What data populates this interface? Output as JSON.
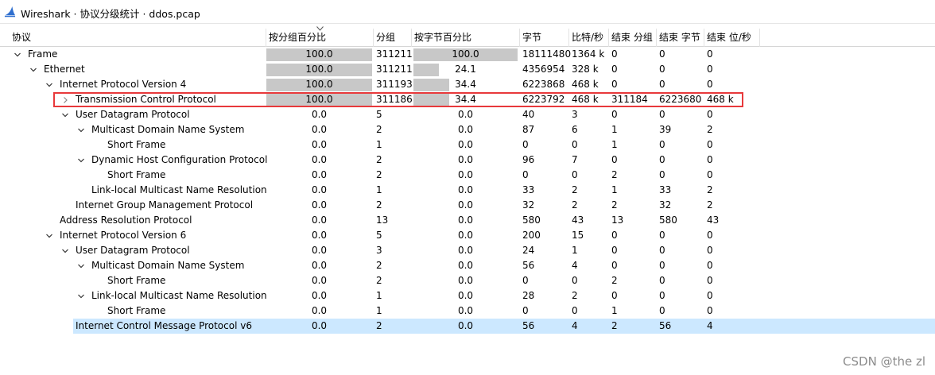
{
  "window": {
    "title": "Wireshark · 协议分级统计 · ddos.pcap",
    "icon": "wireshark-fin-icon"
  },
  "columns": [
    "协议",
    "按分组百分比",
    "分组",
    "按字节百分比",
    "字节",
    "比特/秒",
    "结束 分组",
    "结束 字节",
    "结束 位/秒"
  ],
  "sorted_column_index": 1,
  "rows": [
    {
      "depth": 0,
      "toggle": "expanded",
      "protocol": "Frame",
      "pct_packets": "100.0",
      "packets": "311211",
      "pct_bytes": "100.0",
      "bytes": "18111480",
      "bps": "1364 k",
      "end_packets": "0",
      "end_bytes": "0",
      "end_bps": "0",
      "pct_packets_fill": 100,
      "pct_bytes_fill": 100
    },
    {
      "depth": 1,
      "toggle": "expanded",
      "protocol": "Ethernet",
      "pct_packets": "100.0",
      "packets": "311211",
      "pct_bytes": "24.1",
      "bytes": "4356954",
      "bps": "328 k",
      "end_packets": "0",
      "end_bytes": "0",
      "end_bps": "0",
      "pct_packets_fill": 100,
      "pct_bytes_fill": 24.1
    },
    {
      "depth": 2,
      "toggle": "expanded",
      "protocol": "Internet Protocol Version 4",
      "pct_packets": "100.0",
      "packets": "311193",
      "pct_bytes": "34.4",
      "bytes": "6223868",
      "bps": "468 k",
      "end_packets": "0",
      "end_bytes": "0",
      "end_bps": "0",
      "pct_packets_fill": 100,
      "pct_bytes_fill": 34.4
    },
    {
      "depth": 3,
      "toggle": "collapsed",
      "protocol": "Transmission Control Protocol",
      "pct_packets": "100.0",
      "packets": "311186",
      "pct_bytes": "34.4",
      "bytes": "6223792",
      "bps": "468 k",
      "end_packets": "311184",
      "end_bytes": "6223680",
      "end_bps": "468 k",
      "pct_packets_fill": 100,
      "pct_bytes_fill": 34.4
    },
    {
      "depth": 3,
      "toggle": "expanded",
      "protocol": "User Datagram Protocol",
      "pct_packets": "0.0",
      "packets": "5",
      "pct_bytes": "0.0",
      "bytes": "40",
      "bps": "3",
      "end_packets": "0",
      "end_bytes": "0",
      "end_bps": "0",
      "pct_packets_fill": 0,
      "pct_bytes_fill": 0
    },
    {
      "depth": 4,
      "toggle": "expanded",
      "protocol": "Multicast Domain Name System",
      "pct_packets": "0.0",
      "packets": "2",
      "pct_bytes": "0.0",
      "bytes": "87",
      "bps": "6",
      "end_packets": "1",
      "end_bytes": "39",
      "end_bps": "2",
      "pct_packets_fill": 0,
      "pct_bytes_fill": 0
    },
    {
      "depth": 5,
      "toggle": "none",
      "protocol": "Short Frame",
      "pct_packets": "0.0",
      "packets": "1",
      "pct_bytes": "0.0",
      "bytes": "0",
      "bps": "0",
      "end_packets": "1",
      "end_bytes": "0",
      "end_bps": "0",
      "pct_packets_fill": 0,
      "pct_bytes_fill": 0
    },
    {
      "depth": 4,
      "toggle": "expanded",
      "protocol": "Dynamic Host Configuration Protocol",
      "pct_packets": "0.0",
      "packets": "2",
      "pct_bytes": "0.0",
      "bytes": "96",
      "bps": "7",
      "end_packets": "0",
      "end_bytes": "0",
      "end_bps": "0",
      "pct_packets_fill": 0,
      "pct_bytes_fill": 0
    },
    {
      "depth": 5,
      "toggle": "none",
      "protocol": "Short Frame",
      "pct_packets": "0.0",
      "packets": "2",
      "pct_bytes": "0.0",
      "bytes": "0",
      "bps": "0",
      "end_packets": "2",
      "end_bytes": "0",
      "end_bps": "0",
      "pct_packets_fill": 0,
      "pct_bytes_fill": 0
    },
    {
      "depth": 4,
      "toggle": "none",
      "protocol": "Link-local Multicast Name Resolution",
      "pct_packets": "0.0",
      "packets": "1",
      "pct_bytes": "0.0",
      "bytes": "33",
      "bps": "2",
      "end_packets": "1",
      "end_bytes": "33",
      "end_bps": "2",
      "pct_packets_fill": 0,
      "pct_bytes_fill": 0
    },
    {
      "depth": 3,
      "toggle": "none",
      "protocol": "Internet Group Management Protocol",
      "pct_packets": "0.0",
      "packets": "2",
      "pct_bytes": "0.0",
      "bytes": "32",
      "bps": "2",
      "end_packets": "2",
      "end_bytes": "32",
      "end_bps": "2",
      "pct_packets_fill": 0,
      "pct_bytes_fill": 0
    },
    {
      "depth": 2,
      "toggle": "none",
      "protocol": "Address Resolution Protocol",
      "pct_packets": "0.0",
      "packets": "13",
      "pct_bytes": "0.0",
      "bytes": "580",
      "bps": "43",
      "end_packets": "13",
      "end_bytes": "580",
      "end_bps": "43",
      "pct_packets_fill": 0,
      "pct_bytes_fill": 0
    },
    {
      "depth": 2,
      "toggle": "expanded",
      "protocol": "Internet Protocol Version 6",
      "pct_packets": "0.0",
      "packets": "5",
      "pct_bytes": "0.0",
      "bytes": "200",
      "bps": "15",
      "end_packets": "0",
      "end_bytes": "0",
      "end_bps": "0",
      "pct_packets_fill": 0,
      "pct_bytes_fill": 0
    },
    {
      "depth": 3,
      "toggle": "expanded",
      "protocol": "User Datagram Protocol",
      "pct_packets": "0.0",
      "packets": "3",
      "pct_bytes": "0.0",
      "bytes": "24",
      "bps": "1",
      "end_packets": "0",
      "end_bytes": "0",
      "end_bps": "0",
      "pct_packets_fill": 0,
      "pct_bytes_fill": 0
    },
    {
      "depth": 4,
      "toggle": "expanded",
      "protocol": "Multicast Domain Name System",
      "pct_packets": "0.0",
      "packets": "2",
      "pct_bytes": "0.0",
      "bytes": "56",
      "bps": "4",
      "end_packets": "0",
      "end_bytes": "0",
      "end_bps": "0",
      "pct_packets_fill": 0,
      "pct_bytes_fill": 0
    },
    {
      "depth": 5,
      "toggle": "none",
      "protocol": "Short Frame",
      "pct_packets": "0.0",
      "packets": "2",
      "pct_bytes": "0.0",
      "bytes": "0",
      "bps": "0",
      "end_packets": "2",
      "end_bytes": "0",
      "end_bps": "0",
      "pct_packets_fill": 0,
      "pct_bytes_fill": 0
    },
    {
      "depth": 4,
      "toggle": "expanded",
      "protocol": "Link-local Multicast Name Resolution",
      "pct_packets": "0.0",
      "packets": "1",
      "pct_bytes": "0.0",
      "bytes": "28",
      "bps": "2",
      "end_packets": "0",
      "end_bytes": "0",
      "end_bps": "0",
      "pct_packets_fill": 0,
      "pct_bytes_fill": 0
    },
    {
      "depth": 5,
      "toggle": "none",
      "protocol": "Short Frame",
      "pct_packets": "0.0",
      "packets": "1",
      "pct_bytes": "0.0",
      "bytes": "0",
      "bps": "0",
      "end_packets": "1",
      "end_bytes": "0",
      "end_bps": "0",
      "pct_packets_fill": 0,
      "pct_bytes_fill": 0
    },
    {
      "depth": 3,
      "toggle": "none",
      "protocol": "Internet Control Message Protocol v6",
      "pct_packets": "0.0",
      "packets": "2",
      "pct_bytes": "0.0",
      "bytes": "56",
      "bps": "4",
      "end_packets": "2",
      "end_bytes": "56",
      "end_bps": "4",
      "pct_packets_fill": 0,
      "pct_bytes_fill": 0,
      "selected": true
    }
  ],
  "highlighted_row_index": 3,
  "watermark": "CSDN @the zl",
  "colors": {
    "bar_fill": "#c8c8c8",
    "selection": "#cce8ff",
    "highlight_border": "#e8393b",
    "icon_blue": "#2f6fcf"
  }
}
